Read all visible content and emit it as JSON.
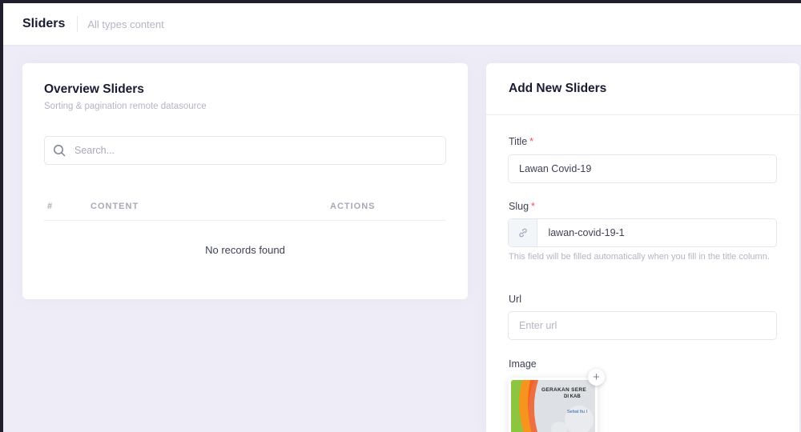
{
  "subheader": {
    "title": "Sliders",
    "description": "All types content"
  },
  "overview": {
    "title": "Overview Sliders",
    "subtitle": "Sorting & pagination remote datasource",
    "search_placeholder": "Search...",
    "columns": [
      "#",
      "CONTENT",
      "ACTIONS"
    ],
    "empty_message": "No records found"
  },
  "form": {
    "title": "Add New Sliders",
    "title_label": "Title",
    "title_value": "Lawan Covid-19",
    "slug_label": "Slug",
    "slug_value": "lawan-covid-19-1",
    "slug_hint": "This field will be filled automatically when you fill in the title column.",
    "required_mark": "*",
    "url_label": "Url",
    "url_placeholder": "Enter url",
    "image_label": "Image",
    "image_text_line1": "GERAKAN SERE",
    "image_text_line2": "DI KAB",
    "image_text_line3": "Sebat Itu I",
    "add_image_symbol": "+"
  },
  "icons": {
    "search": "search-icon",
    "slug": "link-icon",
    "add": "plus-icon"
  },
  "colors": {
    "accent_required": "#f64e60",
    "page_background": "#eeedf7",
    "muted_text": "#b5b5c3"
  }
}
